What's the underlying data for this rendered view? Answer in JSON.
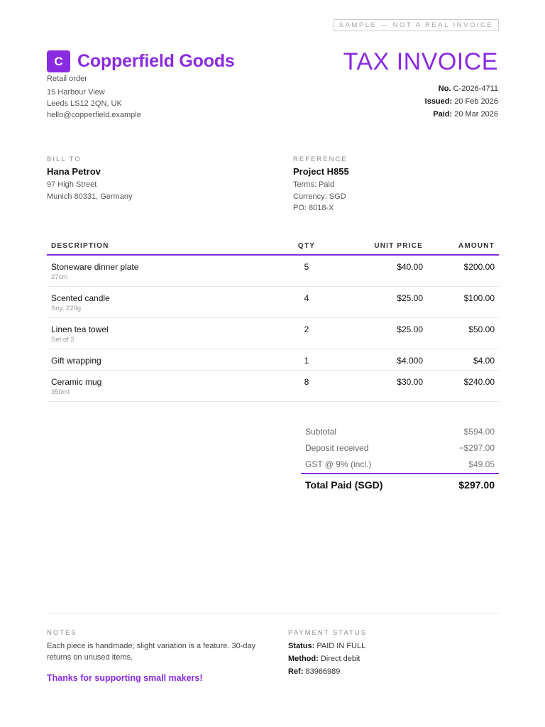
{
  "sample_notice": "SAMPLE — NOT A REAL INVOICE",
  "seller": {
    "logo_letter": "C",
    "name": "Copperfield Goods",
    "subtitle": "Retail order",
    "address_line1": "15 Harbour View",
    "address_line2": "Leeds LS12 2QN, UK",
    "email": "hello@copperfield.example"
  },
  "document": {
    "title": "TAX INVOICE",
    "number_label": "No.",
    "number": "C-2026-4711",
    "issued_label": "Issued:",
    "issued": "20 Feb 2026",
    "paid_label": "Paid:",
    "paid": "20 Mar 2026"
  },
  "bill_to": {
    "label": "BILL TO",
    "name": "Hana Petrov",
    "line1": "97 High Street",
    "line2": "Munich 80331, Germany"
  },
  "reference": {
    "label": "REFERENCE",
    "project": "Project H855",
    "terms": "Terms: Paid",
    "currency": "Currency: SGD",
    "po": "PO: 8018-X"
  },
  "table": {
    "headers": {
      "description": "DESCRIPTION",
      "qty": "QTY",
      "unit_price": "UNIT PRICE",
      "amount": "AMOUNT"
    },
    "rows": [
      {
        "description": "Stoneware dinner plate",
        "sub": "27cm",
        "qty": "5",
        "unit_price": "$40.00",
        "amount": "$200.00"
      },
      {
        "description": "Scented candle",
        "sub": "Soy, 220g",
        "qty": "4",
        "unit_price": "$25.00",
        "amount": "$100.00"
      },
      {
        "description": "Linen tea towel",
        "sub": "Set of 2",
        "qty": "2",
        "unit_price": "$25.00",
        "amount": "$50.00"
      },
      {
        "description": "Gift wrapping",
        "sub": "",
        "qty": "1",
        "unit_price": "$4.000",
        "amount": "$4.00"
      },
      {
        "description": "Ceramic mug",
        "sub": "350ml",
        "qty": "8",
        "unit_price": "$30.00",
        "amount": "$240.00"
      }
    ]
  },
  "totals": {
    "subtotal_label": "Subtotal",
    "subtotal": "$594.00",
    "deposit_label": "Deposit received",
    "deposit": "−$297.00",
    "gst_label": "GST @ 9% (incl.)",
    "gst": "$49.05",
    "total_label": "Total Paid (SGD)",
    "total": "$297.00"
  },
  "notes": {
    "label": "NOTES",
    "text": "Each piece is handmade; slight variation is a feature. 30-day returns on unused items.",
    "thanks": "Thanks for supporting small makers!"
  },
  "payment": {
    "label": "PAYMENT STATUS",
    "status_label": "Status:",
    "status": "PAID IN FULL",
    "method_label": "Method:",
    "method": "Direct debit",
    "ref_label": "Ref:",
    "ref": "83966989"
  }
}
